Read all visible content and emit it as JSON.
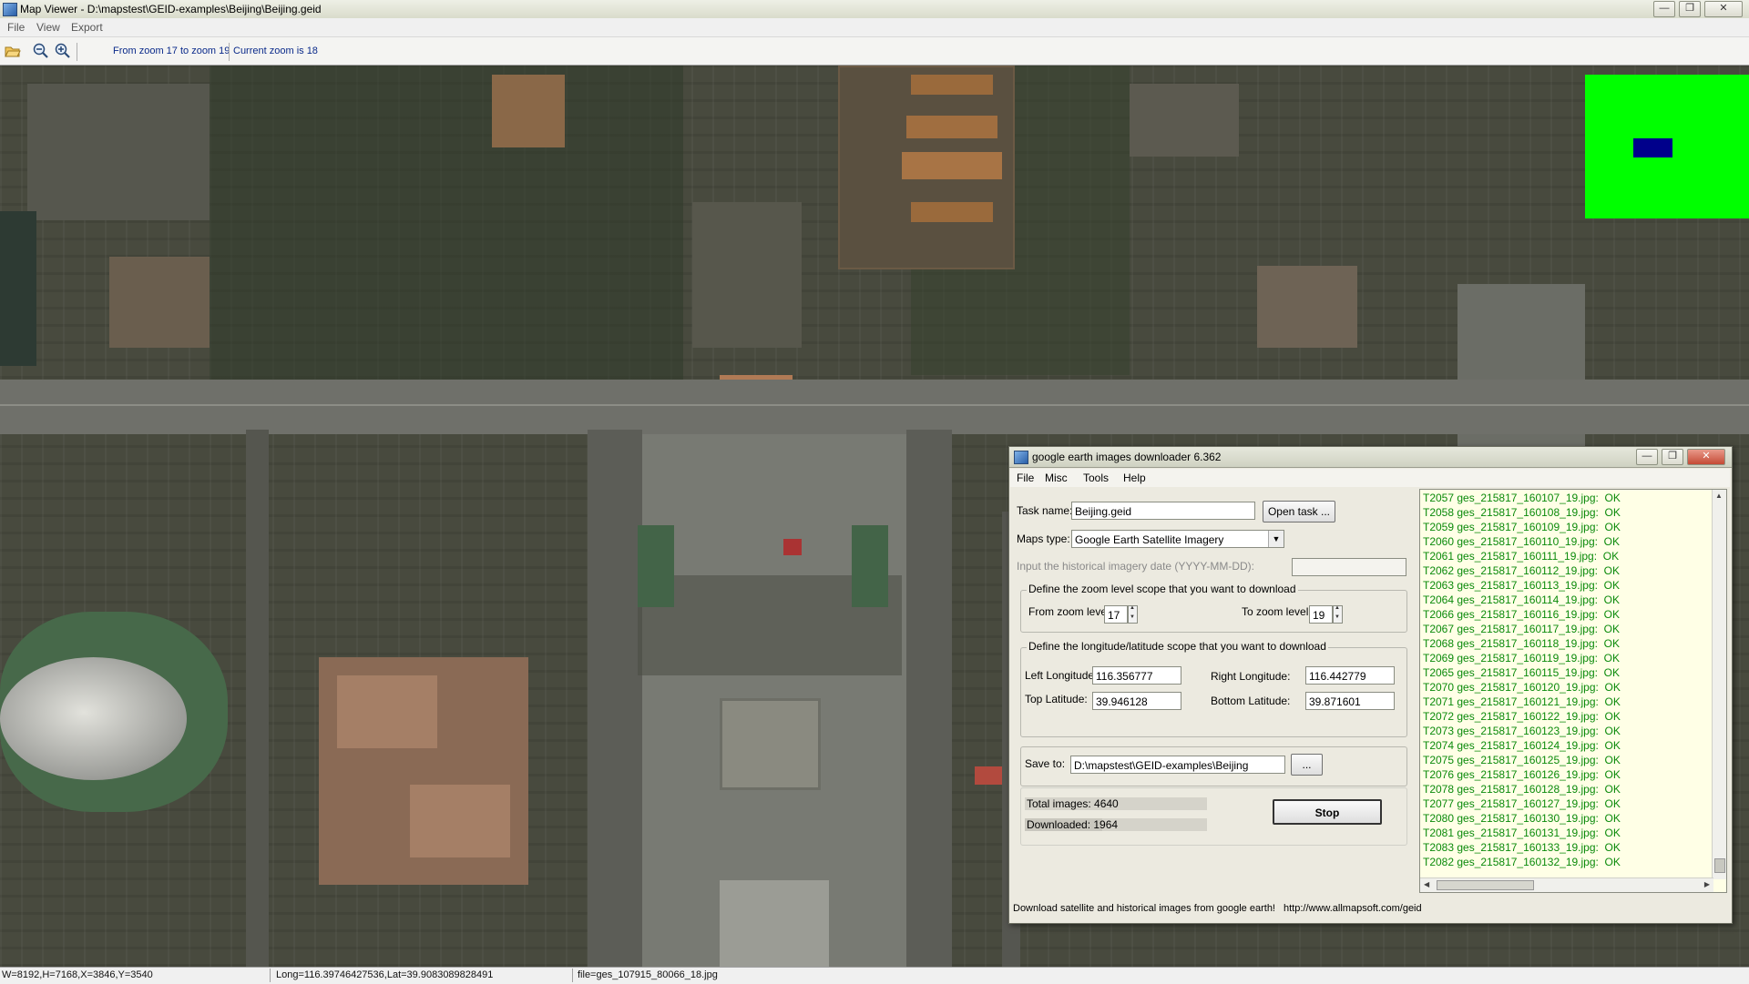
{
  "main_window": {
    "title": "Map Viewer - D:\\mapstest\\GEID-examples\\Beijing\\Beijing.geid",
    "menu": [
      "File",
      "View",
      "Export"
    ],
    "toolbar": {
      "zoom_range_text": "From zoom 17 to zoom 19",
      "current_zoom_text": "Current zoom is 18"
    },
    "controls": {
      "minimize": "—",
      "maximize": "❐",
      "close": "✕"
    }
  },
  "overview": {
    "background": "#00ff00",
    "marker_color": "#00008b"
  },
  "status_bar": {
    "dimensions": "W=8192,H=7168,X=3846,Y=3540",
    "coords": "Long=116.39746427536,Lat=39.9083089828491",
    "file": "file=ges_107915_80066_18.jpg"
  },
  "dialog": {
    "title": "google earth images downloader 6.362",
    "menu": [
      "File",
      "Misc",
      "Tools",
      "Help"
    ],
    "task_name_label": "Task name:",
    "task_name_value": "Beijing.geid",
    "open_task_label": "Open task ...",
    "maps_type_label": "Maps type:",
    "maps_type_value": "Google Earth Satellite Imagery",
    "historical_label": "Input the  historical imagery date (YYYY-MM-DD):",
    "historical_value": "",
    "zoom_group_title": "Define the zoom level scope that you want to download",
    "from_zoom_label": "From zoom level",
    "from_zoom_value": "17",
    "to_zoom_label": "To zoom level",
    "to_zoom_value": "19",
    "coord_group_title": "Define the longitude/latitude scope that you want to download",
    "left_lon_label": "Left Longitude:",
    "left_lon_value": "116.356777",
    "right_lon_label": "Right Longitude:",
    "right_lon_value": "116.442779",
    "top_lat_label": "Top Latitude:",
    "top_lat_value": "39.946128",
    "bottom_lat_label": "Bottom Latitude:",
    "bottom_lat_value": "39.871601",
    "save_to_label": "Save to:",
    "save_to_value": "D:\\mapstest\\GEID-examples\\Beijing",
    "browse_label": "...",
    "total_images_text": "Total images: 4640",
    "downloaded_text": "Downloaded: 1964",
    "download_fraction": 0.4233,
    "stop_label": "Stop",
    "footer_text": "Download satellite and historical  images from google earth!",
    "footer_url": "http://www.allmapsoft.com/geid",
    "log_color": "#0b8a0b",
    "log": [
      "T2057 ges_215817_160107_19.jpg:  OK",
      "T2058 ges_215817_160108_19.jpg:  OK",
      "T2059 ges_215817_160109_19.jpg:  OK",
      "T2060 ges_215817_160110_19.jpg:  OK",
      "T2061 ges_215817_160111_19.jpg:  OK",
      "T2062 ges_215817_160112_19.jpg:  OK",
      "T2063 ges_215817_160113_19.jpg:  OK",
      "T2064 ges_215817_160114_19.jpg:  OK",
      "T2066 ges_215817_160116_19.jpg:  OK",
      "T2067 ges_215817_160117_19.jpg:  OK",
      "T2068 ges_215817_160118_19.jpg:  OK",
      "T2069 ges_215817_160119_19.jpg:  OK",
      "T2065 ges_215817_160115_19.jpg:  OK",
      "T2070 ges_215817_160120_19.jpg:  OK",
      "T2071 ges_215817_160121_19.jpg:  OK",
      "T2072 ges_215817_160122_19.jpg:  OK",
      "T2073 ges_215817_160123_19.jpg:  OK",
      "T2074 ges_215817_160124_19.jpg:  OK",
      "T2075 ges_215817_160125_19.jpg:  OK",
      "T2076 ges_215817_160126_19.jpg:  OK",
      "T2078 ges_215817_160128_19.jpg:  OK",
      "T2077 ges_215817_160127_19.jpg:  OK",
      "T2080 ges_215817_160130_19.jpg:  OK",
      "T2081 ges_215817_160131_19.jpg:  OK",
      "T2083 ges_215817_160133_19.jpg:  OK",
      "T2082 ges_215817_160132_19.jpg:  OK"
    ]
  }
}
